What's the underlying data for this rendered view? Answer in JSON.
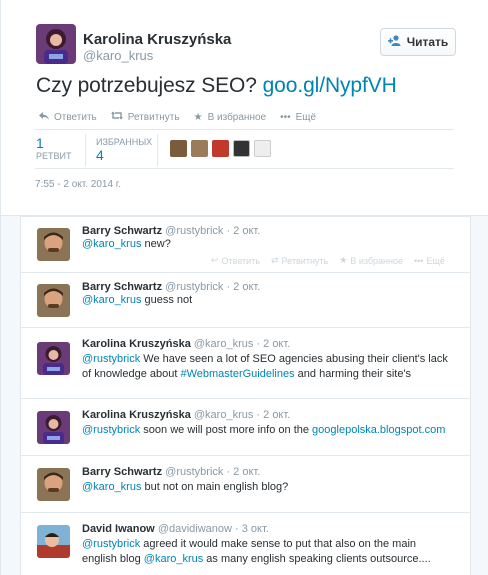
{
  "main": {
    "author_name": "Karolina Kruszyńska",
    "author_handle": "@karo_krus",
    "follow_label": "Читать",
    "text": "Czy potrzebujesz SEO?",
    "link": "goo.gl/NypfVH",
    "actions": {
      "reply": "Ответить",
      "retweet": "Ретвитнуть",
      "favorite": "В избранное",
      "more": "Ещё"
    },
    "stats": {
      "retweets_count": "1",
      "retweets_label": "РЕТВИТ",
      "favorites_label": "ИЗБРАННЫХ",
      "favorites_count": "4"
    },
    "timestamp": "7:55 - 2 окт. 2014 г."
  },
  "reply_actions": {
    "reply": "Ответить",
    "retweet": "Ретвитнуть",
    "favorite": "В избранное",
    "more": "Ещё"
  },
  "replies": [
    {
      "name": "Barry Schwartz",
      "handle": "@rustybrick",
      "date": "· 2 окт.",
      "mention": "@karo_krus",
      "text": " new?"
    },
    {
      "name": "Barry Schwartz",
      "handle": "@rustybrick",
      "date": "· 2 окт.",
      "mention": "@karo_krus",
      "text": " guess not"
    },
    {
      "name": "Karolina Kruszyńska",
      "handle": "@karo_krus",
      "date": "· 2 окт.",
      "mention": "@rustybrick",
      "text1": " We have seen a lot of SEO agencies abusing their client's lack of knowledge about ",
      "hashtag": "#WebmasterGuidelines",
      "text2": " and harming their site's"
    },
    {
      "name": "Karolina Kruszyńska",
      "handle": "@karo_krus",
      "date": "· 2 окт.",
      "mention": "@rustybrick",
      "text1": " soon we will post more info on the ",
      "link": "googlepolska.blogspot.com"
    },
    {
      "name": "Barry Schwartz",
      "handle": "@rustybrick",
      "date": "· 2 окт.",
      "mention": "@karo_krus",
      "text": " but not on main english blog?"
    },
    {
      "name": "David Iwanow",
      "handle": "@davidiwanow",
      "date": "· 3 окт.",
      "mention": "@rustybrick",
      "text1": " agreed it would make sense to put that also on the main english blog ",
      "mention2": "@karo_krus",
      "text2": " as many english speaking clients outsource...."
    }
  ],
  "colors": {
    "link": "#0084b4",
    "muted": "#8899a6",
    "background": "#f5f8fa"
  },
  "icons": [
    "follow-person-icon",
    "reply-icon",
    "retweet-icon",
    "favorite-star-icon",
    "more-dots-icon"
  ]
}
